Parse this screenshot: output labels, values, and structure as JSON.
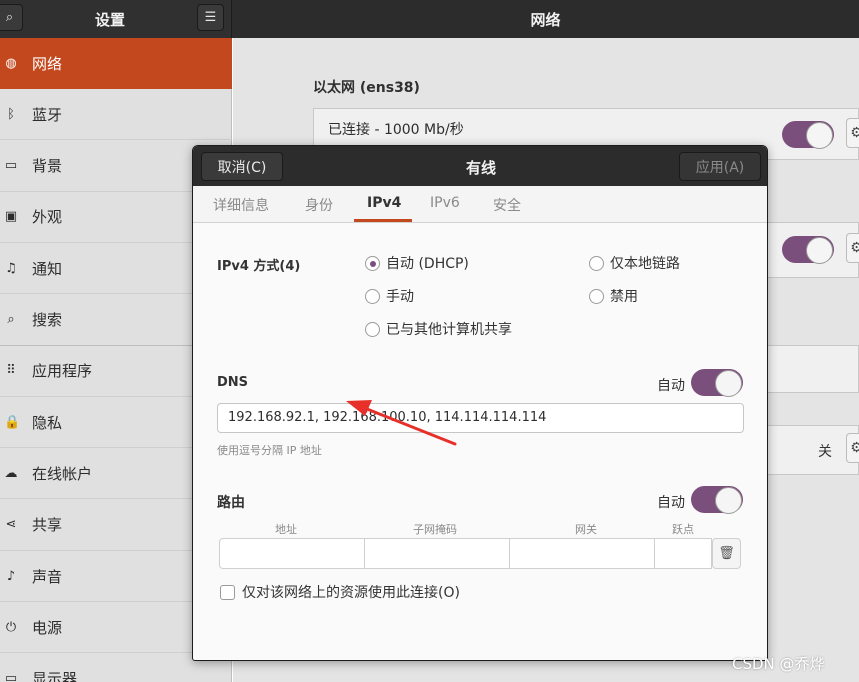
{
  "window": {
    "left_title": "设置",
    "right_title": "网络"
  },
  "sidebar": {
    "items": [
      {
        "label": "网络",
        "icon": "globe-icon",
        "glyph": "◍"
      },
      {
        "label": "蓝牙",
        "icon": "bluetooth-icon",
        "glyph": "ᛒ"
      },
      {
        "label": "背景",
        "icon": "monitor-icon",
        "glyph": "▭"
      },
      {
        "label": "外观",
        "icon": "appearance-icon",
        "glyph": "▣"
      },
      {
        "label": "通知",
        "icon": "bell-icon",
        "glyph": "♫"
      },
      {
        "label": "搜索",
        "icon": "search-icon",
        "glyph": "⌕"
      },
      {
        "label": "应用程序",
        "icon": "apps-grid-icon",
        "glyph": "⠿"
      },
      {
        "label": "隐私",
        "icon": "lock-icon",
        "glyph": "🔒"
      },
      {
        "label": "在线帐户",
        "icon": "cloud-icon",
        "glyph": "☁"
      },
      {
        "label": "共享",
        "icon": "share-icon",
        "glyph": "⋖"
      },
      {
        "label": "声音",
        "icon": "music-note-icon",
        "glyph": "♪"
      },
      {
        "label": "电源",
        "icon": "power-icon",
        "glyph": "⏻"
      },
      {
        "label": "显示器",
        "icon": "display-icon",
        "glyph": "▭"
      }
    ]
  },
  "network": {
    "ethernet_title": "以太网 (ens38)",
    "connection_status": "已连接 - 1000 Mb/秒",
    "off_label": "关"
  },
  "dialog": {
    "cancel_label": "取消(C)",
    "title": "有线",
    "apply_label": "应用(A)",
    "tabs": [
      {
        "label": "详细信息"
      },
      {
        "label": "身份"
      },
      {
        "label": "IPv4"
      },
      {
        "label": "IPv6"
      },
      {
        "label": "安全"
      }
    ],
    "active_tab": "IPv4",
    "ipv4_method_label": "IPv4 方式(4)",
    "methods": {
      "auto_dhcp": "自动 (DHCP)",
      "link_local": "仅本地链路",
      "manual": "手动",
      "disabled": "禁用",
      "shared": "已与其他计算机共享"
    },
    "selected_method": "自动 (DHCP)",
    "dns_label": "DNS",
    "dns_auto_label": "自动",
    "dns_auto_on": true,
    "dns_value": "192.168.92.1, 192.168.100.10, 114.114.114.114",
    "dns_hint": "使用逗号分隔 IP 地址",
    "route_label": "路由",
    "route_auto_label": "自动",
    "route_auto_on": true,
    "route_columns": [
      "地址",
      "子网掩码",
      "网关",
      "跃点"
    ],
    "only_local_resources_label": "仅对该网络上的资源使用此连接(O)",
    "only_local_resources_checked": false
  },
  "colors": {
    "accent": "#c4481e",
    "toggle_on": "#7b4f7b",
    "header_bg": "#2c2c2c",
    "annotation_arrow": "#e8302a"
  },
  "watermark": "CSDN @乔烨"
}
